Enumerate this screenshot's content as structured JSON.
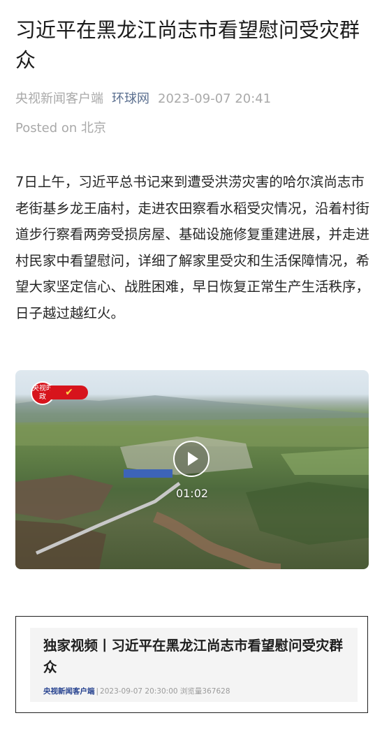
{
  "article": {
    "title": "习近平在黑龙江尚志市看望慰问受灾群众",
    "source_primary": "央视新闻客户端",
    "source_secondary": "环球网",
    "datetime": "2023-09-07 20:41",
    "posted_on": "Posted on 北京",
    "body": "7日上午，习近平总书记来到遭受洪涝灾害的哈尔滨尚志市老街基乡龙王庙村，走进农田察看水稻受灾情况，沿着村街道步行察看两旁受损房屋、基础设施修复重建进展，并走进村民家中看望慰问，详细了解家里受灾和生活保障情况，希望大家坚定信心、战胜困难，早日恢复正常生产生活秩序，日子越过越红火。"
  },
  "video": {
    "badge_text": "央视时政",
    "duration": "01:02",
    "icons": {
      "play": "play-icon"
    }
  },
  "card": {
    "title": "独家视频丨习近平在黑龙江尚志市看望慰问受灾群众",
    "source": "央视新闻客户端",
    "separator": "|",
    "datetime": "2023-09-07 20:30:00",
    "views": "浏览量367628"
  },
  "colors": {
    "accent_link": "#5b6f8f",
    "brand_red": "#d7141c",
    "card_source": "#24408e"
  }
}
